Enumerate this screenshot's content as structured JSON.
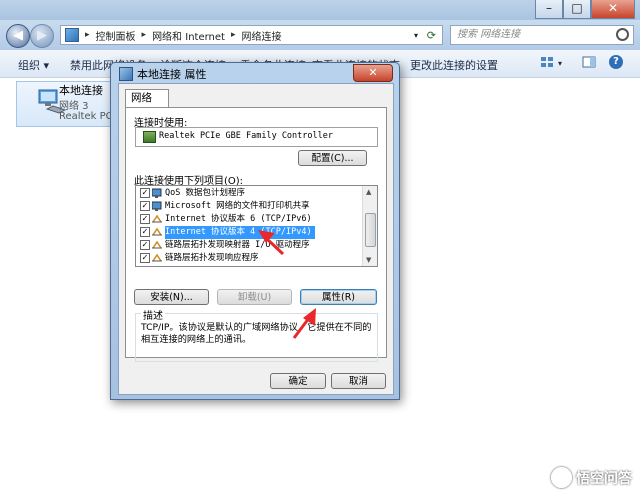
{
  "address": {
    "breadcrumbs": [
      "控制面板",
      "网络和 Internet",
      "网络连接"
    ],
    "search_placeholder": "搜索 网络连接"
  },
  "command_bar": {
    "organize": "组织",
    "disable_device": "禁用此网络设备",
    "diagnose": "诊断这个连接",
    "rename": "重命名此连接",
    "view_status": "查看此连接的状态",
    "change_settings": "更改此连接的设置"
  },
  "connection": {
    "name": "本地连接",
    "network": "网络  3",
    "device": "Realtek PCIe GBE Family Controller"
  },
  "dialog": {
    "title": "本地连接 属性",
    "tab": "网络",
    "connect_using_label": "连接时使用:",
    "adapter": "Realtek PCIe GBE Family Controller",
    "configure_button": "配置(C)...",
    "items_label": "此连接使用下列项目(O):",
    "items": [
      {
        "label": "QoS 数据包计划程序",
        "checked": true,
        "selected": false
      },
      {
        "label": "Microsoft 网络的文件和打印机共享",
        "checked": true,
        "selected": false
      },
      {
        "label": "Internet 协议版本 6 (TCP/IPv6)",
        "checked": true,
        "selected": false
      },
      {
        "label": "Internet 协议版本 4 (TCP/IPv4)",
        "checked": true,
        "selected": true
      },
      {
        "label": "链路层拓扑发现映射器 I/O 驱动程序",
        "checked": true,
        "selected": false
      },
      {
        "label": "链路层拓扑发现响应程序",
        "checked": true,
        "selected": false
      }
    ],
    "install_button": "安装(N)...",
    "uninstall_button": "卸载(U)",
    "properties_button": "属性(R)",
    "description_label": "描述",
    "description_text": "TCP/IP。该协议是默认的广域网络协议，它提供在不同的相互连接的网络上的通讯。",
    "ok_button": "确定",
    "cancel_button": "取消"
  },
  "watermark": "悟空问答",
  "colors": {
    "selection": "#3399ff",
    "annotation_arrow": "#e8282b",
    "title_bar": "#b9d2ec"
  }
}
